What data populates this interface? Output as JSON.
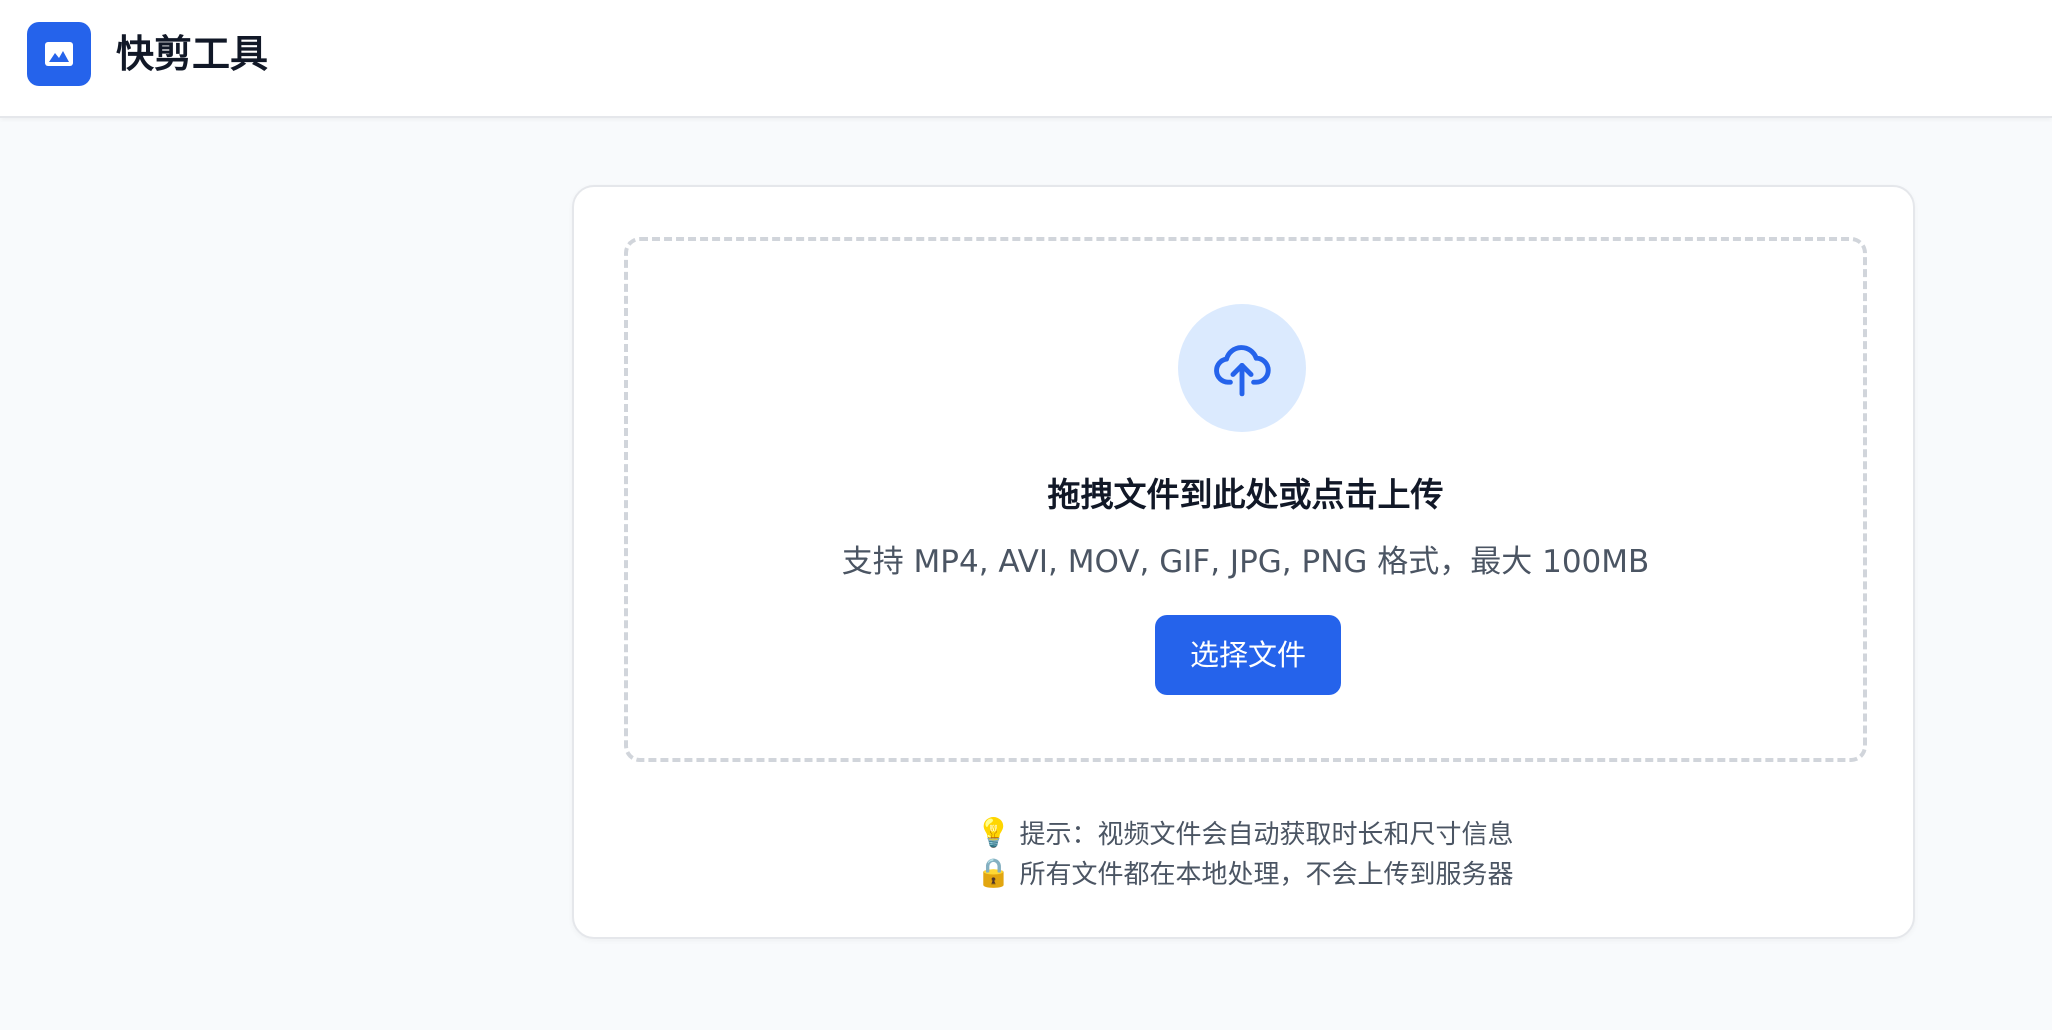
{
  "app": {
    "title": "快剪工具",
    "logo_icon": "image-icon",
    "accent_color": "#2563eb"
  },
  "upload": {
    "icon": "cloud-upload-icon",
    "title": "拖拽文件到此处或点击上传",
    "subtitle": "支持 MP4, AVI, MOV, GIF, JPG, PNG 格式，最大 100MB",
    "button_label": "选择文件"
  },
  "tips": [
    {
      "icon": "lightbulb-icon",
      "glyph": "💡",
      "text": "提示：视频文件会自动获取时长和尺寸信息"
    },
    {
      "icon": "lock-icon",
      "glyph": "🔒",
      "text": "所有文件都在本地处理，不会上传到服务器"
    }
  ]
}
